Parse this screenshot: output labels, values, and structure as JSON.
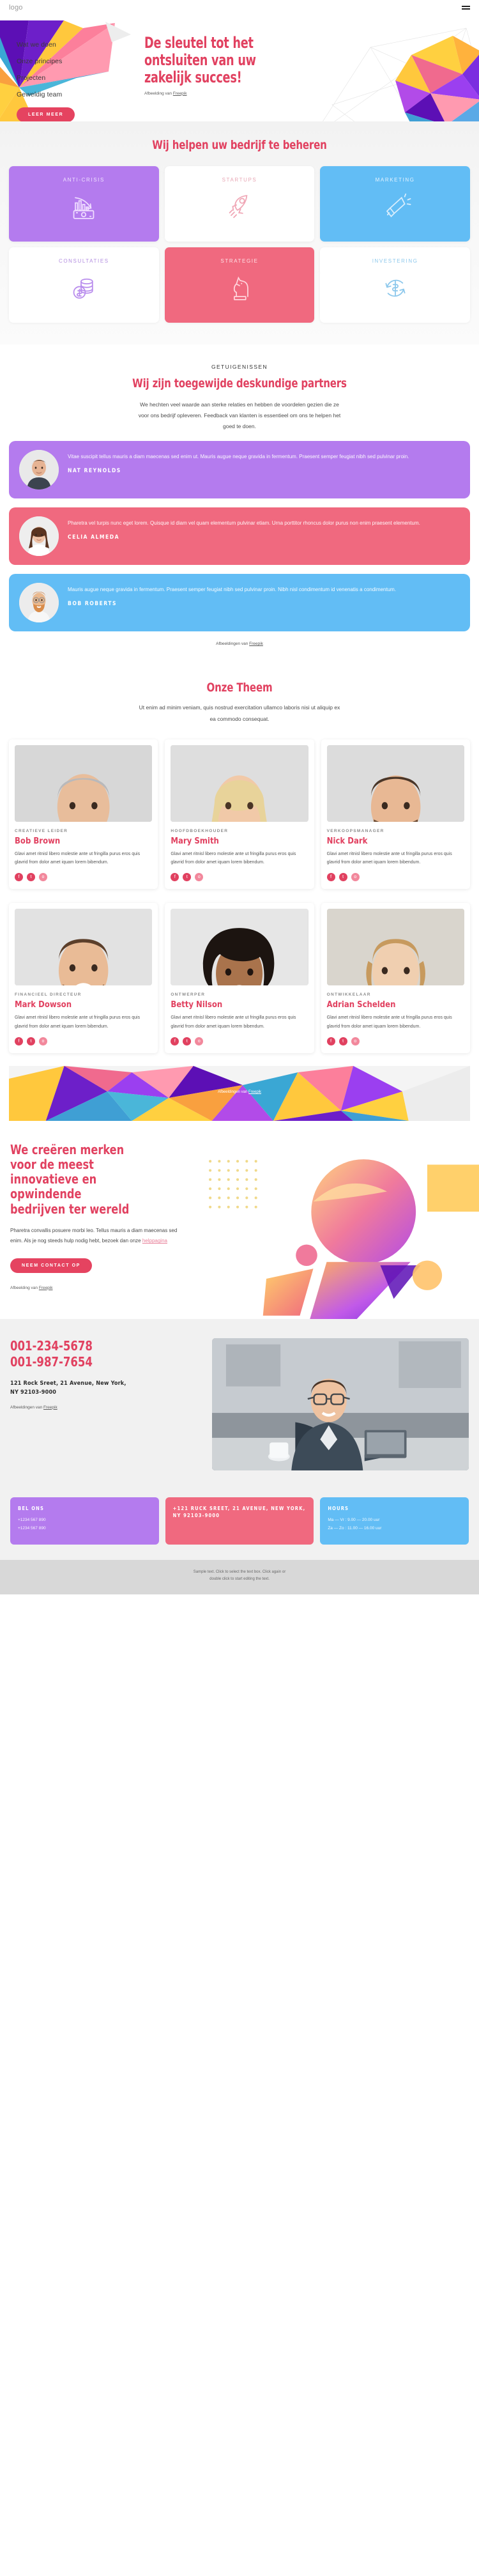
{
  "header": {
    "logo": "logo",
    "menu_icon": "hamburger-menu-icon"
  },
  "hero": {
    "nav": [
      {
        "label": "Wat we doen"
      },
      {
        "label": "Onze principes"
      },
      {
        "label": "Projecten"
      },
      {
        "label": "Geweldig team"
      }
    ],
    "cta_label": "LEER MEER",
    "title_lines": [
      "De sleutel tot het",
      "ontsluiten van uw",
      "zakelijk succes!"
    ],
    "credit_prefix": "Afbeelding van ",
    "credit_link": "Freepik"
  },
  "services": {
    "title": "Wij helpen uw bedrijf te beheren",
    "cards": [
      {
        "label": "ANTI-CRISIS",
        "icon": "falling-chart-money-icon",
        "theme": "c-purple"
      },
      {
        "label": "STARTUPS",
        "icon": "rocket-icon",
        "theme": "c-white"
      },
      {
        "label": "MARKETING",
        "icon": "megaphone-icon",
        "theme": "c-blue"
      },
      {
        "label": "CONSULTATIES",
        "icon": "coins-dollar-icon",
        "theme": "c-white2"
      },
      {
        "label": "STRATEGIE",
        "icon": "chess-knight-icon",
        "theme": "c-pink"
      },
      {
        "label": "INVESTERING",
        "icon": "dollar-refresh-icon",
        "theme": "c-white3"
      }
    ]
  },
  "testimonials": {
    "eyebrow": "GETUIGENISSEN",
    "title": "Wij zijn toegewijde deskundige partners",
    "subtitle": "We hechten veel waarde aan sterke relaties en hebben de voordelen gezien die ze voor ons bedrijf opleveren. Feedback van klanten is essentieel om ons te helpen het goed te doen.",
    "items": [
      {
        "text": "Vitae suscipit tellus mauris a diam maecenas sed enim ut. Mauris augue neque gravida in fermentum. Praesent semper feugiat nibh sed pulvinar proin.",
        "name": "NAT REYNOLDS",
        "theme": "t-purple"
      },
      {
        "text": "Pharetra vel turpis nunc eget lorem. Quisque id diam vel quam elementum pulvinar etiam. Urna porttitor rhoncus dolor purus non enim praesent elementum.",
        "name": "CELIA ALMEDA",
        "theme": "t-pink"
      },
      {
        "text": "Mauris augue neque gravida in fermentum. Praesent semper feugiat nibh sed pulvinar proin. Nibh nisl condimentum id venenatis a condimentum.",
        "name": "BOB ROBERTS",
        "theme": "t-blue"
      }
    ],
    "credit_prefix": "Afbeeldingen van ",
    "credit_link": "Freepik"
  },
  "team": {
    "title": "Onze Theem",
    "subtitle": "Ut enim ad minim veniam, quis nostrud exercitation ullamco laboris nisi ut aliquip ex ea commodo consequat.",
    "members": [
      {
        "role": "CREATIEVE LEIDER",
        "name": "Bob Brown",
        "bio": "Glavi amet ritnisl libero molestie ante ut fringilla purus eros quis glavrid from dolor amet iquam lorem bibendum."
      },
      {
        "role": "HOOFDBOEKHOUDER",
        "name": "Mary Smith",
        "bio": "Glavi amet ritnisl libero molestie ante ut fringilla purus eros quis glavrid from dolor amet iquam lorem bibendum."
      },
      {
        "role": "VERKOOPSMANAGER",
        "name": "Nick Dark",
        "bio": "Glavi amet ritnisl libero molestie ante ut fringilla purus eros quis glavrid from dolor amet iquam lorem bibendum."
      },
      {
        "role": "FINANCIEEL DIRECTEUR",
        "name": "Mark Dowson",
        "bio": "Glavi amet ritnisl libero molestie ante ut fringilla purus eros quis glavrid from dolor amet iquam lorem bibendum."
      },
      {
        "role": "ONTWERPER",
        "name": "Betty Nilson",
        "bio": "Glavi amet ritnisl libero molestie ante ut fringilla purus eros quis glavrid from dolor amet iquam lorem bibendum."
      },
      {
        "role": "ONTWIKKELAAR",
        "name": "Adrian Schelden",
        "bio": "Glavi amet ritnisl libero molestie ante ut fringilla purus eros quis glavrid from dolor amet iquam lorem bibendum."
      }
    ],
    "socials": [
      "f",
      "t",
      "o"
    ],
    "credit_prefix": "Afbeeldingen van ",
    "credit_link": "Freepik"
  },
  "brands": {
    "title_lines": [
      "We creëren merken",
      "voor de meest",
      "innovatieve en",
      "opwindende",
      "bedrijven ter wereld"
    ],
    "text": "Pharetra convallis posuere morbi leo. Tellus mauris a diam maecenas sed enim. Als je nog steeds hulp nodig hebt, bezoek dan onze ",
    "link": "helppagina",
    "cta_label": "NEEM CONTACT OP",
    "credit_prefix": "Afbeelding van ",
    "credit_link": "Freepik"
  },
  "contact": {
    "phone1": "001-234-5678",
    "phone2": "001-987-7654",
    "address_lines": [
      "121 Rock Sreet, 21 Avenue, New York,",
      "NY 92103-9000"
    ],
    "credit_prefix": "Afbeeldingen van ",
    "credit_link": "Freepik"
  },
  "footer_cards": [
    {
      "title": "BEL ONS",
      "lines": [
        "+1234 567 890",
        "+1234 567 890"
      ],
      "theme": "f-purple"
    },
    {
      "title": "+121 RUCK SREET, 21 AVENUE, NEW YORK, NY 92103-9000",
      "lines": [],
      "theme": "f-pink"
    },
    {
      "title": "HOURS",
      "lines": [
        "Ma — Vr : 9.00 — 20.00 uur",
        "Za — Zo : 11.00 — 16.00 uur"
      ],
      "theme": "f-blue"
    }
  ],
  "bottom": {
    "line1": "Sample text. Click to select the text box. Click again or",
    "line2": "double click to start editing the text."
  },
  "colors": {
    "accent": "#e14160",
    "purple": "#b47bee",
    "pink": "#f0697f",
    "blue": "#62bdf5"
  }
}
